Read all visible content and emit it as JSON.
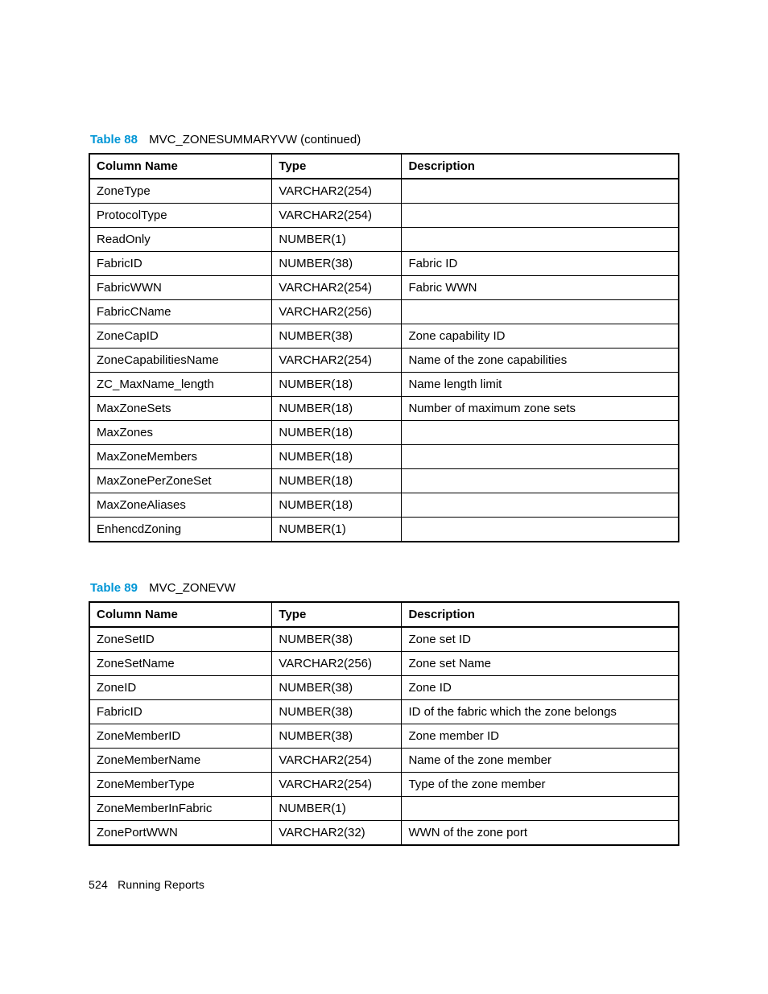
{
  "table88": {
    "label": "Table 88",
    "name": "MVC_ZONESUMMARYVW (continued)",
    "headers": {
      "col1": "Column Name",
      "col2": "Type",
      "col3": "Description"
    },
    "rows": [
      {
        "c1": "ZoneType",
        "c2": "VARCHAR2(254)",
        "c3": ""
      },
      {
        "c1": "ProtocolType",
        "c2": "VARCHAR2(254)",
        "c3": ""
      },
      {
        "c1": "ReadOnly",
        "c2": "NUMBER(1)",
        "c3": ""
      },
      {
        "c1": "FabricID",
        "c2": "NUMBER(38)",
        "c3": "Fabric ID"
      },
      {
        "c1": "FabricWWN",
        "c2": "VARCHAR2(254)",
        "c3": "Fabric WWN"
      },
      {
        "c1": "FabricCName",
        "c2": "VARCHAR2(256)",
        "c3": ""
      },
      {
        "c1": "ZoneCapID",
        "c2": "NUMBER(38)",
        "c3": "Zone capability ID"
      },
      {
        "c1": "ZoneCapabilitiesName",
        "c2": "VARCHAR2(254)",
        "c3": "Name of the zone capabilities"
      },
      {
        "c1": "ZC_MaxName_length",
        "c2": "NUMBER(18)",
        "c3": "Name length limit"
      },
      {
        "c1": "MaxZoneSets",
        "c2": "NUMBER(18)",
        "c3": "Number of maximum zone sets"
      },
      {
        "c1": "MaxZones",
        "c2": "NUMBER(18)",
        "c3": ""
      },
      {
        "c1": "MaxZoneMembers",
        "c2": "NUMBER(18)",
        "c3": ""
      },
      {
        "c1": "MaxZonePerZoneSet",
        "c2": "NUMBER(18)",
        "c3": ""
      },
      {
        "c1": "MaxZoneAliases",
        "c2": "NUMBER(18)",
        "c3": ""
      },
      {
        "c1": "EnhencdZoning",
        "c2": "NUMBER(1)",
        "c3": ""
      }
    ]
  },
  "table89": {
    "label": "Table 89",
    "name": "MVC_ZONEVW",
    "headers": {
      "col1": "Column Name",
      "col2": "Type",
      "col3": "Description"
    },
    "rows": [
      {
        "c1": "ZoneSetID",
        "c2": "NUMBER(38)",
        "c3": "Zone set ID"
      },
      {
        "c1": "ZoneSetName",
        "c2": "VARCHAR2(256)",
        "c3": "Zone set Name"
      },
      {
        "c1": "ZoneID",
        "c2": "NUMBER(38)",
        "c3": "Zone ID"
      },
      {
        "c1": "FabricID",
        "c2": "NUMBER(38)",
        "c3": "ID of the fabric which the zone belongs"
      },
      {
        "c1": "ZoneMemberID",
        "c2": "NUMBER(38)",
        "c3": "Zone member ID"
      },
      {
        "c1": "ZoneMemberName",
        "c2": "VARCHAR2(254)",
        "c3": "Name of the zone member"
      },
      {
        "c1": "ZoneMemberType",
        "c2": "VARCHAR2(254)",
        "c3": "Type of the zone member"
      },
      {
        "c1": "ZoneMemberInFabric",
        "c2": "NUMBER(1)",
        "c3": ""
      },
      {
        "c1": "ZonePortWWN",
        "c2": "VARCHAR2(32)",
        "c3": "WWN of the zone port"
      }
    ]
  },
  "footer": {
    "page_number": "524",
    "section": "Running Reports"
  }
}
